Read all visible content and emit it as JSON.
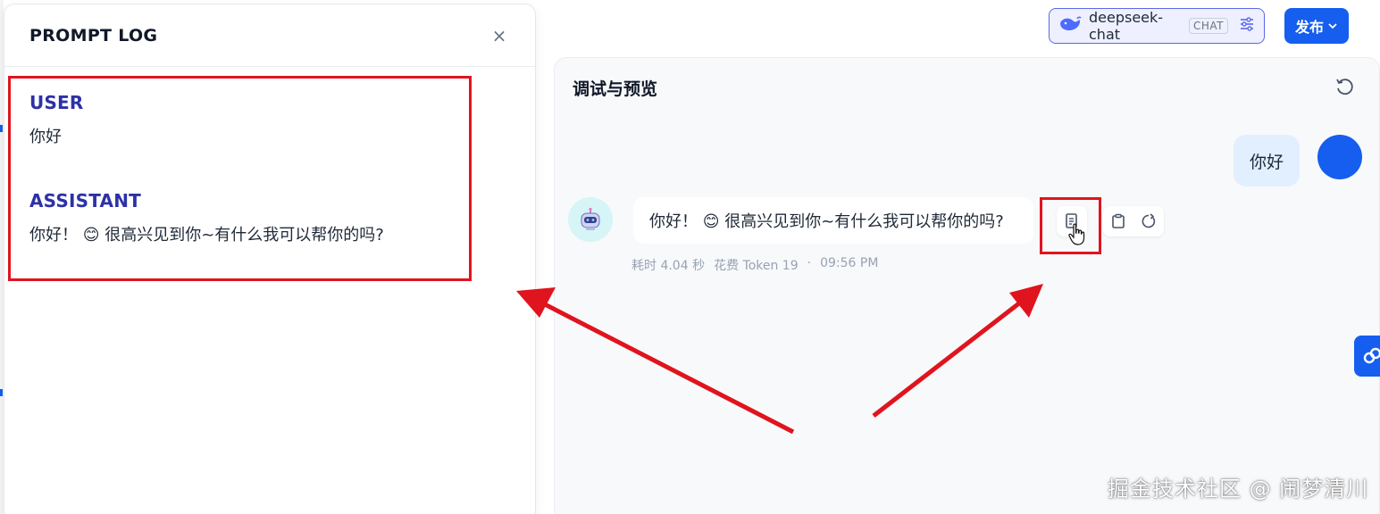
{
  "prompt_log": {
    "title": "PROMPT LOG",
    "close_symbol": "×",
    "entries": [
      {
        "role": "USER",
        "text": "你好"
      },
      {
        "role": "ASSISTANT",
        "text": "你好！ 😊 很高兴见到你~有什么我可以帮你的吗?"
      }
    ]
  },
  "toolbar": {
    "model_name": "deepseek-chat",
    "model_badge": "CHAT",
    "publish_label": "发布"
  },
  "debug": {
    "title": "调试与预览",
    "user_message": "你好",
    "assistant_message": "你好！ 😊 很高兴见到你~有什么我可以帮你的吗?",
    "meta": {
      "elapsed": "耗时 4.04 秒",
      "tokens": "花费 Token 19",
      "separator": "·",
      "time": "09:56 PM"
    }
  },
  "watermark": "掘金技术社区 @ 闹梦清川",
  "colors": {
    "accent": "#155eef",
    "highlight": "#e0141e",
    "role_label": "#2d31a6",
    "user_bubble": "#e1effe"
  }
}
